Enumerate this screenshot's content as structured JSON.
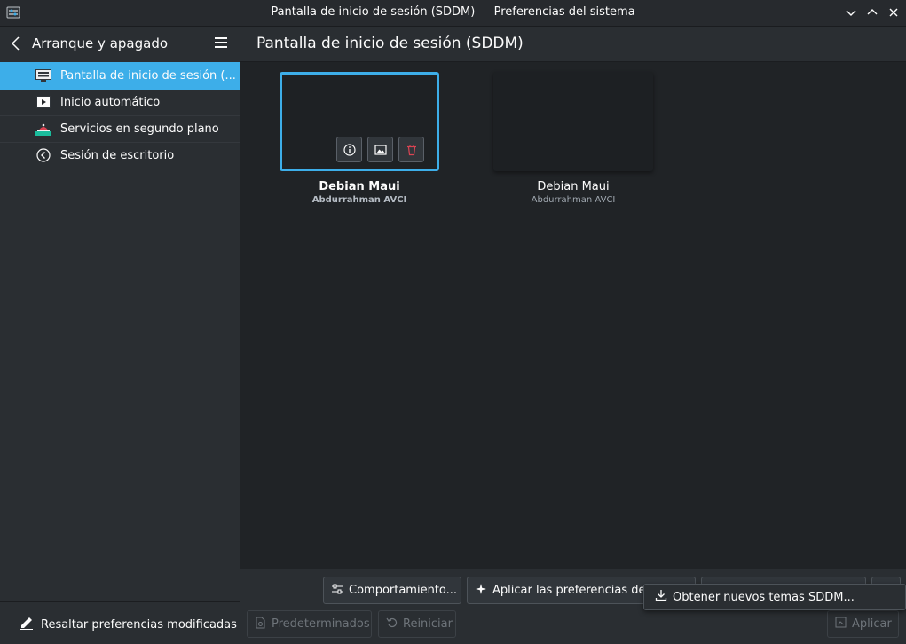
{
  "window": {
    "title": "Pantalla de inicio de sesión (SDDM) — Preferencias del sistema"
  },
  "sidebar": {
    "header_label": "Arranque y apagado",
    "items": [
      {
        "label": "Pantalla de inicio de sesión (...",
        "icon": "monitor-login-icon",
        "selected": true
      },
      {
        "label": "Inicio automático",
        "icon": "autostart-icon",
        "selected": false
      },
      {
        "label": "Servicios en segundo plano",
        "icon": "services-icon",
        "selected": false
      },
      {
        "label": "Sesión de escritorio",
        "icon": "desktop-session-icon",
        "selected": false
      }
    ],
    "footer_button": "Resaltar preferencias modificadas"
  },
  "main": {
    "title": "Pantalla de inicio de sesión (SDDM)",
    "themes": [
      {
        "name": "Debian Maui",
        "author": "Abdurrahman AVCI",
        "selected": true
      },
      {
        "name": "Debian Maui",
        "author": "Abdurrahman AVCI",
        "selected": false
      }
    ]
  },
  "bottom_bar": {
    "behavior_button": "Comportamiento...",
    "apply_plasma_button": "Aplicar las preferencias de P",
    "get_new_themes": "Obtener nuevos temas SDDM...",
    "defaults_button": "Predeterminados",
    "reset_button": "Reiniciar",
    "apply_button": "Aplicar"
  },
  "colors": {
    "accent": "#3daee9",
    "window_bg": "#202326",
    "panel_bg": "#2a2e32",
    "delete_red": "#da4453"
  }
}
